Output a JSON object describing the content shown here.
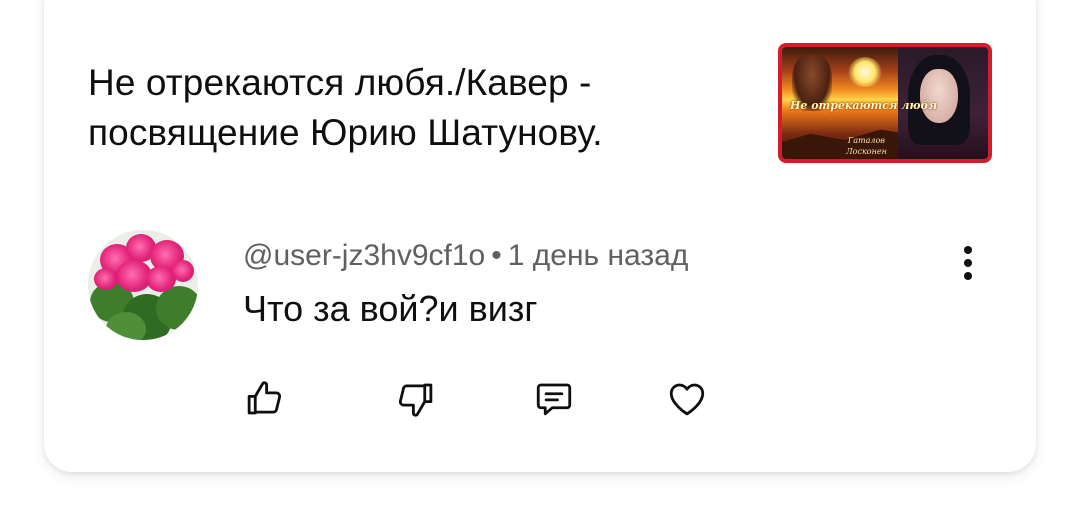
{
  "video": {
    "title_line1": "Не отрекаются любя./Кавер -",
    "title_line2": "посвящение Юрию Шатунову.",
    "thumbnail": {
      "overlay_text": "Не отрекаются любя",
      "caption_line1": "Гаталов",
      "caption_line2": "Лосконен"
    }
  },
  "comment": {
    "author": "@user-jz3hv9cf1o",
    "separator": "•",
    "time": "1 день назад",
    "text": "Что за вой?и визг",
    "avatar_icon": "pink-geranium-flowers"
  },
  "actions": [
    {
      "name": "like",
      "icon": "thumb-up-icon"
    },
    {
      "name": "dislike",
      "icon": "thumb-down-icon"
    },
    {
      "name": "reply",
      "icon": "comment-icon"
    },
    {
      "name": "heart",
      "icon": "heart-icon"
    }
  ],
  "colors": {
    "primary_text": "#0f0f0f",
    "secondary_text": "#606060",
    "thumbnail_border": "#d11e2a"
  }
}
